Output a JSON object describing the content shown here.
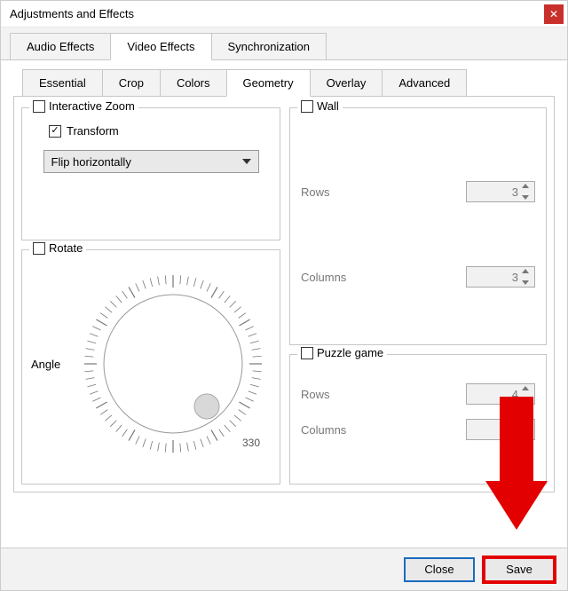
{
  "window": {
    "title": "Adjustments and Effects"
  },
  "tabs": {
    "audio": "Audio Effects",
    "video": "Video Effects",
    "sync": "Synchronization"
  },
  "subtabs": {
    "essential": "Essential",
    "crop": "Crop",
    "colors": "Colors",
    "geometry": "Geometry",
    "overlay": "Overlay",
    "advanced": "Advanced"
  },
  "geometry": {
    "interactive_zoom": "Interactive Zoom",
    "transform": "Transform",
    "transform_value": "Flip horizontally",
    "rotate": "Rotate",
    "angle_label": "Angle",
    "angle_tick": "330",
    "wall": "Wall",
    "wall_rows_label": "Rows",
    "wall_rows_value": "3",
    "wall_cols_label": "Columns",
    "wall_cols_value": "3",
    "puzzle": "Puzzle game",
    "puzzle_rows_label": "Rows",
    "puzzle_rows_value": "4",
    "puzzle_cols_label": "Columns",
    "puzzle_cols_value": ""
  },
  "buttons": {
    "close": "Close",
    "save": "Save"
  }
}
